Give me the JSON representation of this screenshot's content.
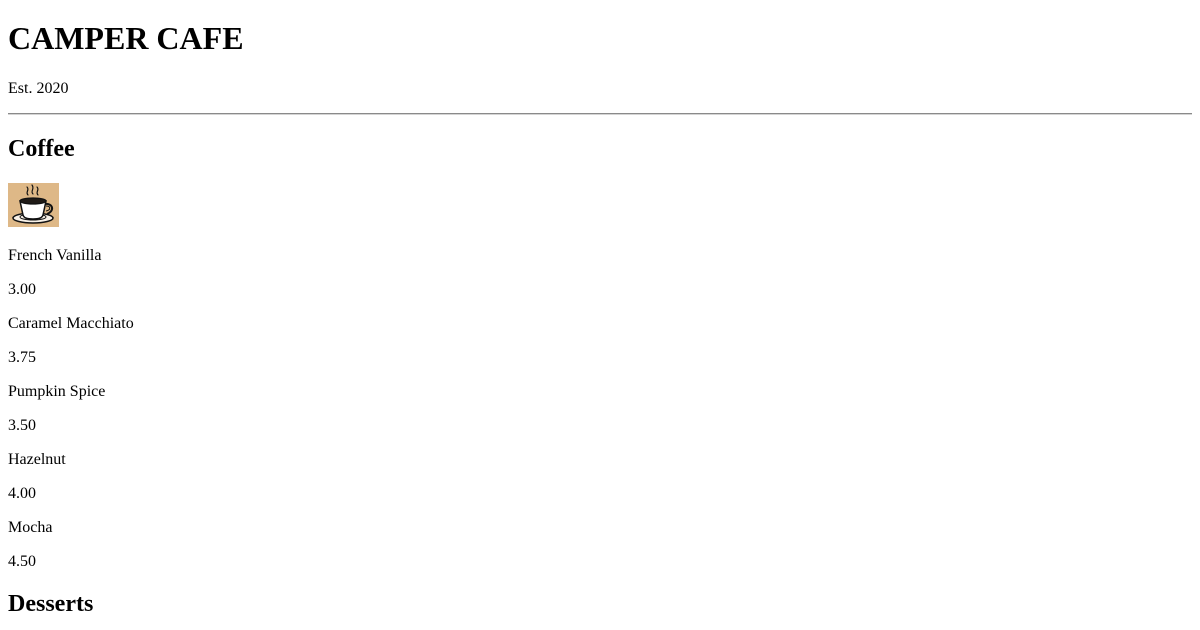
{
  "header": {
    "title": "CAMPER CAFE",
    "established": "Est. 2020"
  },
  "coffee": {
    "heading": "Coffee",
    "image_icon": "coffee-cup-icon",
    "image_background": "#deb887",
    "items": [
      {
        "name": "French Vanilla",
        "price": "3.00"
      },
      {
        "name": "Caramel Macchiato",
        "price": "3.75"
      },
      {
        "name": "Pumpkin Spice",
        "price": "3.50"
      },
      {
        "name": "Hazelnut",
        "price": "4.00"
      },
      {
        "name": "Mocha",
        "price": "4.50"
      }
    ]
  },
  "desserts": {
    "heading": "Desserts"
  }
}
